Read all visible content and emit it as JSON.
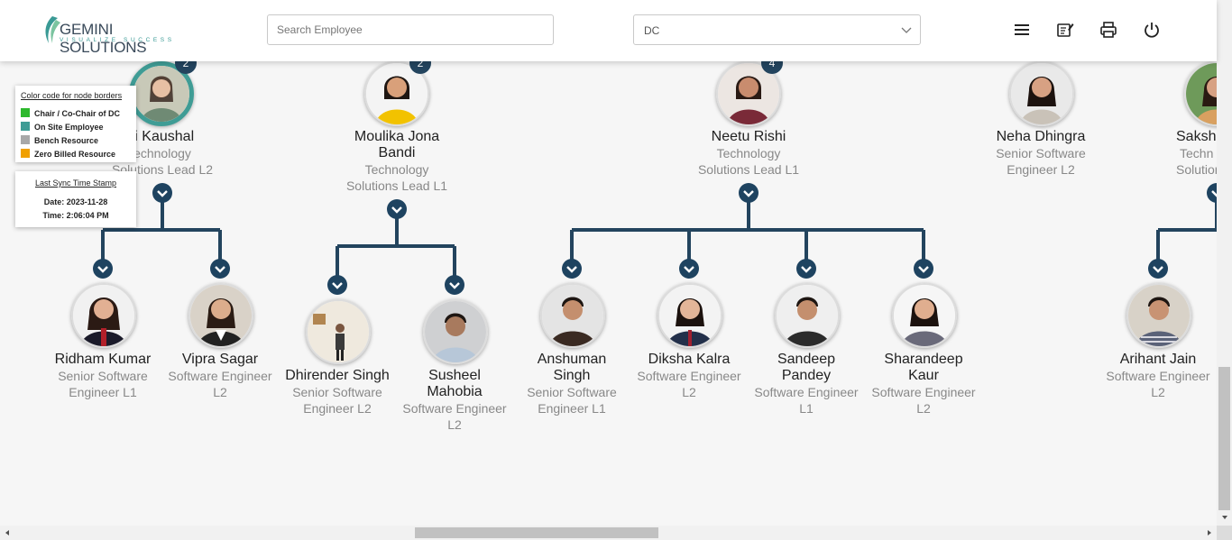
{
  "header": {
    "logo": {
      "brand": "GEMINI SOLUTIONS",
      "tagline": "VISUALIZE SUCCESS"
    },
    "search": {
      "placeholder": "Search Employee",
      "value": ""
    },
    "dc_select": {
      "value": "DC"
    },
    "icons": [
      "menu-icon",
      "edit-notes-icon",
      "print-icon",
      "power-icon"
    ]
  },
  "legend": {
    "title": "Color code for node borders",
    "items": [
      {
        "label": "Chair / Co-Chair of DC",
        "color": "#2db82d"
      },
      {
        "label": "On Site Employee",
        "color": "#3f9c95"
      },
      {
        "label": "Bench Resource",
        "color": "#a8a8a8"
      },
      {
        "label": "Zero Billed Resource",
        "color": "#f0a000"
      }
    ]
  },
  "sync": {
    "title": "Last Sync Time Stamp",
    "date": "Date: 2023-11-28",
    "time": "Time: 2:06:04 PM"
  },
  "colors": {
    "connector": "#23445e",
    "onsite_border": "#3f9c95"
  },
  "nodes": {
    "kaushal": {
      "name": "ti Kaushal",
      "role1": "echnology",
      "role2": "Solutions Lead L2",
      "badge": "2"
    },
    "moulika": {
      "name1": "Moulika Jona",
      "name2": "Bandi",
      "role1": "Technology",
      "role2": "Solutions Lead L1",
      "badge": "2"
    },
    "neetu": {
      "name": "Neetu Rishi",
      "role1": "Technology",
      "role2": "Solutions Lead L1",
      "badge": "4"
    },
    "neha": {
      "name": "Neha Dhingra",
      "role1": "Senior Software",
      "role2": "Engineer L2"
    },
    "sakshi": {
      "name": "Saksh",
      "role1": "Techn",
      "role2": "Solutions"
    },
    "ridham": {
      "name": "Ridham Kumar",
      "role1": "Senior Software",
      "role2": "Engineer L1"
    },
    "vipra": {
      "name": "Vipra Sagar",
      "role1": "Software Engineer",
      "role2": "L2"
    },
    "dhirender": {
      "name": "Dhirender Singh",
      "role1": "Senior Software",
      "role2": "Engineer L2"
    },
    "susheel": {
      "name1": "Susheel",
      "name2": "Mahobia",
      "role1": "Software Engineer",
      "role2": "L2"
    },
    "anshuman": {
      "name1": "Anshuman",
      "name2": "Singh",
      "role1": "Senior Software",
      "role2": "Engineer L1"
    },
    "diksha": {
      "name": "Diksha Kalra",
      "role1": "Software Engineer",
      "role2": "L2"
    },
    "sandeep": {
      "name1": "Sandeep",
      "name2": "Pandey",
      "role1": "Software Engineer",
      "role2": "L1"
    },
    "sharandeep": {
      "name1": "Sharandeep",
      "name2": "Kaur",
      "role1": "Software Engineer",
      "role2": "L2"
    },
    "arihant": {
      "name": "Arihant Jain",
      "role1": "Software Engineer",
      "role2": "L2"
    }
  }
}
